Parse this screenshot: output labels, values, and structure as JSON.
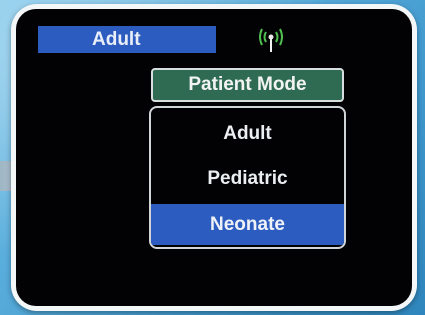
{
  "status_bar": {
    "patient_mode_value": "Adult",
    "signal_icon": "antenna-signal-icon"
  },
  "patient_mode_menu": {
    "title": "Patient Mode",
    "options": [
      {
        "label": "Adult",
        "selected": false
      },
      {
        "label": "Pediatric",
        "selected": false
      },
      {
        "label": "Neonate",
        "selected": true
      }
    ]
  },
  "colors": {
    "selection_blue": "#2c5cc0",
    "menu_title_green": "#2e6b52",
    "screen_black": "#020204",
    "background_blue": "#4aa3d6"
  }
}
